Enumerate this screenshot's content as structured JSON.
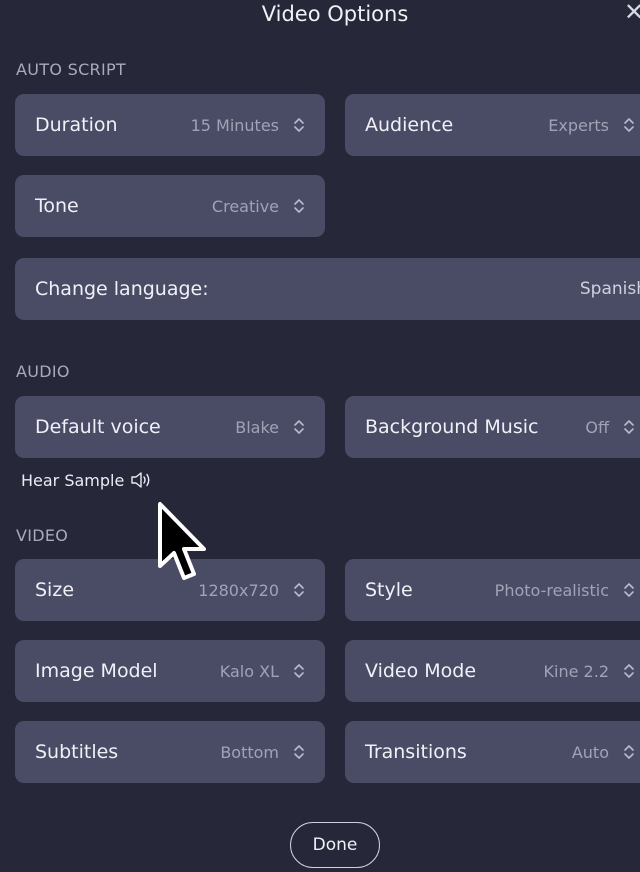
{
  "header": {
    "title": "Video Options",
    "close_icon": "close-icon"
  },
  "sections": {
    "auto_script": {
      "label": "AUTO SCRIPT",
      "duration": {
        "label": "Duration",
        "value": "15 Minutes"
      },
      "audience": {
        "label": "Audience",
        "value": "Experts"
      },
      "tone": {
        "label": "Tone",
        "value": "Creative"
      },
      "language": {
        "label": "Change language:",
        "value": "Spanish"
      }
    },
    "audio": {
      "label": "AUDIO",
      "voice": {
        "label": "Default voice",
        "value": "Blake"
      },
      "music": {
        "label": "Background Music",
        "value": "Off"
      },
      "hear_sample": "Hear Sample"
    },
    "video": {
      "label": "VIDEO",
      "size": {
        "label": "Size",
        "value": "1280x720"
      },
      "style": {
        "label": "Style",
        "value": "Photo-realistic"
      },
      "image_model": {
        "label": "Image Model",
        "value": "Kalo XL"
      },
      "video_mode": {
        "label": "Video Mode",
        "value": "Kine 2.2"
      },
      "subtitles": {
        "label": "Subtitles",
        "value": "Bottom"
      },
      "transitions": {
        "label": "Transitions",
        "value": "Auto"
      }
    }
  },
  "footer": {
    "done_label": "Done"
  },
  "colors": {
    "background": "#262738",
    "card": "#4a4c66",
    "section_label": "#a9aabe",
    "value": "#a0a2b6"
  }
}
